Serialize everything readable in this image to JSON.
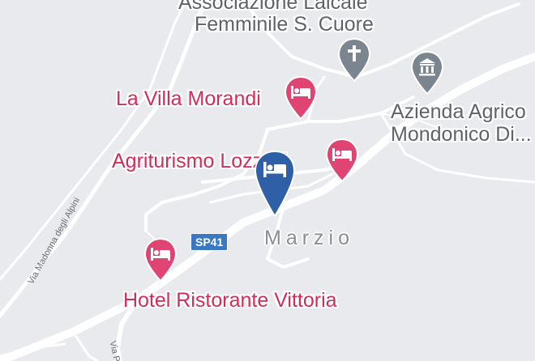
{
  "map": {
    "town_label": "Marzio",
    "road_badge": "SP41",
    "colors": {
      "background": "#e8eaed",
      "road": "#ffffff",
      "hotel_pin": "#e04472",
      "selected_pin": "#2f5fa6",
      "poi_pin": "#7b8590",
      "badge": "#3b78c2"
    }
  },
  "pois": [
    {
      "name": "Associazione Laicale Femminile S. Cuore",
      "line1": "Associazione Laicale",
      "line2": "Femminile S. Cuore",
      "icon": "church-cross-icon"
    },
    {
      "name": "La Villa Morandi",
      "icon": "hotel-bed-icon"
    },
    {
      "name": "Azienda Agricola Mondonico Di...",
      "line1": "Azienda Agrico",
      "line2": "Mondonico Di...",
      "icon": "museum-icon"
    },
    {
      "name": "Agriturismo Lozzelli",
      "text": "Agriturismo Lozzelli",
      "icon": "hotel-bed-icon"
    },
    {
      "name": "Hotel Ristorante Vittoria",
      "icon": "hotel-bed-icon"
    }
  ],
  "selected_pin": {
    "icon": "hotel-bed-icon"
  },
  "streets": [
    "Via Madonna degli Alpini",
    "Via Po"
  ]
}
